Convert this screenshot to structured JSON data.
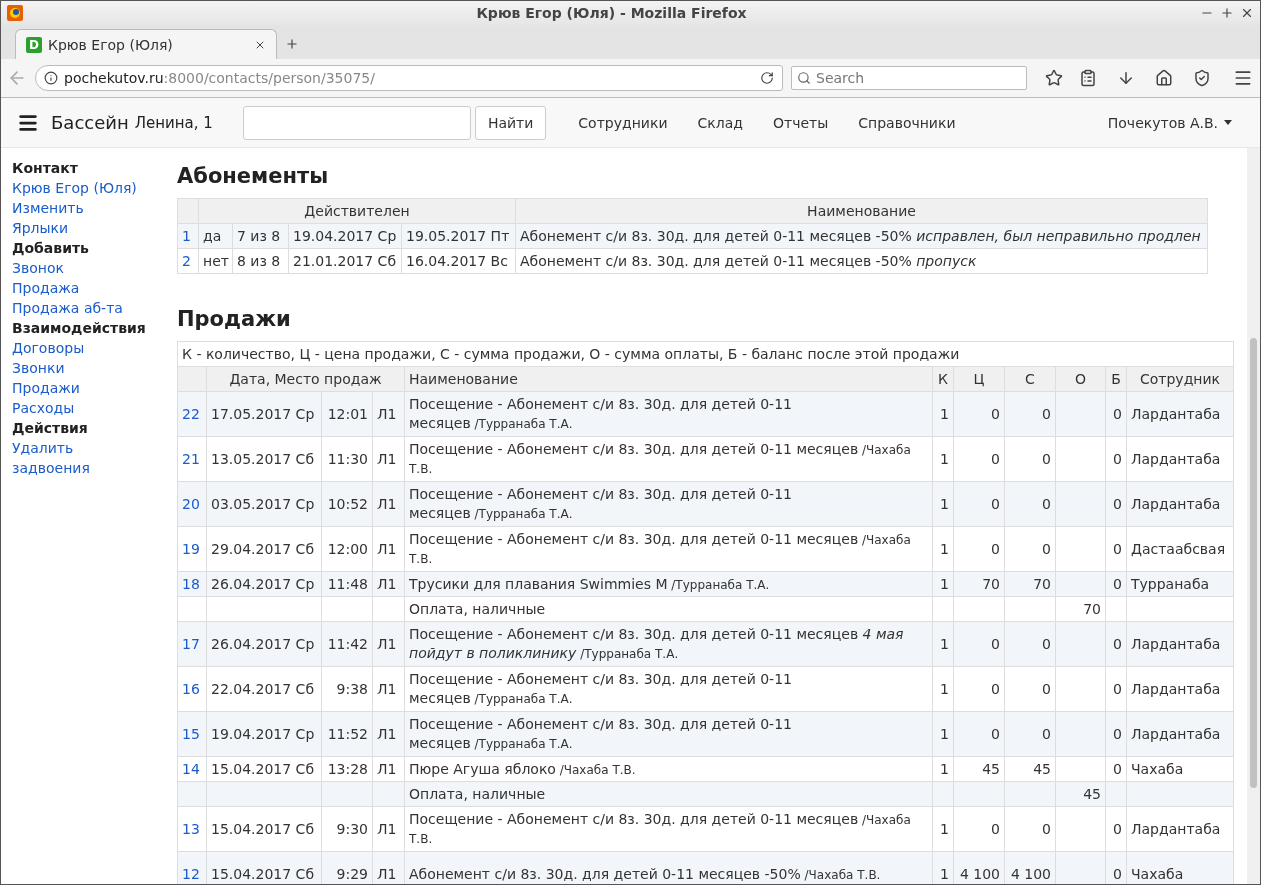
{
  "browser": {
    "window_title": "Крюв Егор (Юля) - Mozilla Firefox",
    "tab_title": "Крюв Егор (Юля)",
    "tab_icon_letter": "D",
    "url_host": "pochekutov.ru",
    "url_rest": ":8000/contacts/person/35075/",
    "search_placeholder": "Search"
  },
  "navbar": {
    "brand": "Бассейн",
    "brand_sub": "Ленина, 1",
    "search_button": "Найти",
    "links": [
      "Сотрудники",
      "Склад",
      "Отчеты",
      "Справочники"
    ],
    "user": "Почекутов А.В."
  },
  "sidebar": {
    "items": [
      {
        "kind": "heading",
        "label": "Контакт"
      },
      {
        "kind": "link",
        "label": "Крюв Егор (Юля)"
      },
      {
        "kind": "link",
        "label": "Изменить"
      },
      {
        "kind": "link",
        "label": "Ярлыки"
      },
      {
        "kind": "heading",
        "label": "Добавить"
      },
      {
        "kind": "link",
        "label": "Звонок"
      },
      {
        "kind": "link",
        "label": "Продажа"
      },
      {
        "kind": "link",
        "label": "Продажа аб-та"
      },
      {
        "kind": "heading",
        "label": "Взаимодействия"
      },
      {
        "kind": "link",
        "label": "Договоры"
      },
      {
        "kind": "link",
        "label": "Звонки"
      },
      {
        "kind": "link",
        "label": "Продажи"
      },
      {
        "kind": "link",
        "label": "Расходы"
      },
      {
        "kind": "heading",
        "label": "Действия"
      },
      {
        "kind": "link",
        "label": "Удалить"
      },
      {
        "kind": "link",
        "label": "задвоения"
      }
    ]
  },
  "subscriptions": {
    "title": "Абонементы",
    "header_valid": "Действителен",
    "header_name": "Наименование",
    "rows": [
      {
        "num": "1",
        "active": "да",
        "used": "7 из 8",
        "start": "19.04.2017 Ср",
        "end": "19.05.2017 Пт",
        "name": "Абонемент с/и 8з. 30д. для детей 0-11 месяцев -50% *исправлен, был неправильно продлен*"
      },
      {
        "num": "2",
        "active": "нет",
        "used": "8 из 8",
        "start": "21.01.2017 Сб",
        "end": "16.04.2017 Вс",
        "name": "Абонемент с/и 8з. 30д. для детей 0-11 месяцев -50% *пропуск*"
      }
    ]
  },
  "sales": {
    "title": "Продажи",
    "legend": "К - количество, Ц - цена продажи, С - сумма продажи, О - сумма оплаты, Б - баланс после этой продажи",
    "columns": [
      "Дата, Место продаж",
      "Наименование",
      "К",
      "Ц",
      "С",
      "О",
      "Б",
      "Сотрудник"
    ],
    "rows": [
      {
        "kind": "sale",
        "num": "22",
        "date": "17.05.2017 Ср",
        "time": "12:01",
        "place": "Л1",
        "name": "Посещение - Абонемент с/и 8з. 30д. для детей 0-11 месяцев",
        "author": "/Турранаба Т.А.",
        "qty": "1",
        "price": "0",
        "sum": "0",
        "balance": "0",
        "employee": "Лардантаба"
      },
      {
        "kind": "sale",
        "num": "21",
        "date": "13.05.2017 Сб",
        "time": "11:30",
        "place": "Л1",
        "name": "Посещение - Абонемент с/и 8з. 30д. для детей 0-11 месяцев",
        "author": "/Чахаба Т.В.",
        "qty": "1",
        "price": "0",
        "sum": "0",
        "balance": "0",
        "employee": "Лардантаба"
      },
      {
        "kind": "sale",
        "num": "20",
        "date": "03.05.2017 Ср",
        "time": "10:52",
        "place": "Л1",
        "name": "Посещение - Абонемент с/и 8з. 30д. для детей 0-11 месяцев",
        "author": "/Турранаба Т.А.",
        "qty": "1",
        "price": "0",
        "sum": "0",
        "balance": "0",
        "employee": "Лардантаба"
      },
      {
        "kind": "sale",
        "num": "19",
        "date": "29.04.2017 Сб",
        "time": "12:00",
        "place": "Л1",
        "name": "Посещение - Абонемент с/и 8з. 30д. для детей 0-11 месяцев",
        "author": "/Чахаба Т.В.",
        "qty": "1",
        "price": "0",
        "sum": "0",
        "balance": "0",
        "employee": "Дастаабсвая"
      },
      {
        "kind": "sale",
        "num": "18",
        "date": "26.04.2017 Ср",
        "time": "11:48",
        "place": "Л1",
        "name": "Трусики для плавания Swimmies M",
        "author": "/Турранаба Т.А.",
        "qty": "1",
        "price": "70",
        "sum": "70",
        "balance": "0",
        "employee": "Турранаба"
      },
      {
        "kind": "payment",
        "name": "Оплата, наличные",
        "paid": "70"
      },
      {
        "kind": "sale",
        "num": "17",
        "date": "26.04.2017 Ср",
        "time": "11:42",
        "place": "Л1",
        "name": "Посещение - Абонемент с/и 8з. 30д. для детей 0-11 месяцев *4 мая пойдут в поликлинику*",
        "author": "/Турранаба Т.А.",
        "qty": "1",
        "price": "0",
        "sum": "0",
        "balance": "0",
        "employee": "Лардантаба"
      },
      {
        "kind": "sale",
        "num": "16",
        "date": "22.04.2017 Сб",
        "time": "9:38",
        "place": "Л1",
        "name": "Посещение - Абонемент с/и 8з. 30д. для детей 0-11 месяцев",
        "author": "/Турранаба Т.А.",
        "qty": "1",
        "price": "0",
        "sum": "0",
        "balance": "0",
        "employee": "Лардантаба"
      },
      {
        "kind": "sale",
        "num": "15",
        "date": "19.04.2017 Ср",
        "time": "11:52",
        "place": "Л1",
        "name": "Посещение - Абонемент с/и 8з. 30д. для детей 0-11 месяцев",
        "author": "/Турранаба Т.А.",
        "qty": "1",
        "price": "0",
        "sum": "0",
        "balance": "0",
        "employee": "Лардантаба"
      },
      {
        "kind": "sale",
        "num": "14",
        "date": "15.04.2017 Сб",
        "time": "13:28",
        "place": "Л1",
        "name": "Пюре Агуша яблоко",
        "author": "/Чахаба Т.В.",
        "qty": "1",
        "price": "45",
        "sum": "45",
        "balance": "0",
        "employee": "Чахаба"
      },
      {
        "kind": "payment",
        "name": "Оплата, наличные",
        "paid": "45"
      },
      {
        "kind": "sale",
        "num": "13",
        "date": "15.04.2017 Сб",
        "time": "9:30",
        "place": "Л1",
        "name": "Посещение - Абонемент с/и 8з. 30д. для детей 0-11 месяцев",
        "author": "/Чахаба Т.В.",
        "qty": "1",
        "price": "0",
        "sum": "0",
        "balance": "0",
        "employee": "Лардантаба"
      },
      {
        "kind": "sale",
        "num": "12",
        "date": "15.04.2017 Сб",
        "time": "9:29",
        "place": "Л1",
        "name": "Абонемент с/и 8з. 30д. для детей 0-11 месяцев -50%",
        "author": "/Чахаба Т.В.",
        "qty": "1",
        "price": "4 100",
        "sum": "4 100",
        "balance": "0",
        "employee": "Чахаба"
      }
    ]
  }
}
